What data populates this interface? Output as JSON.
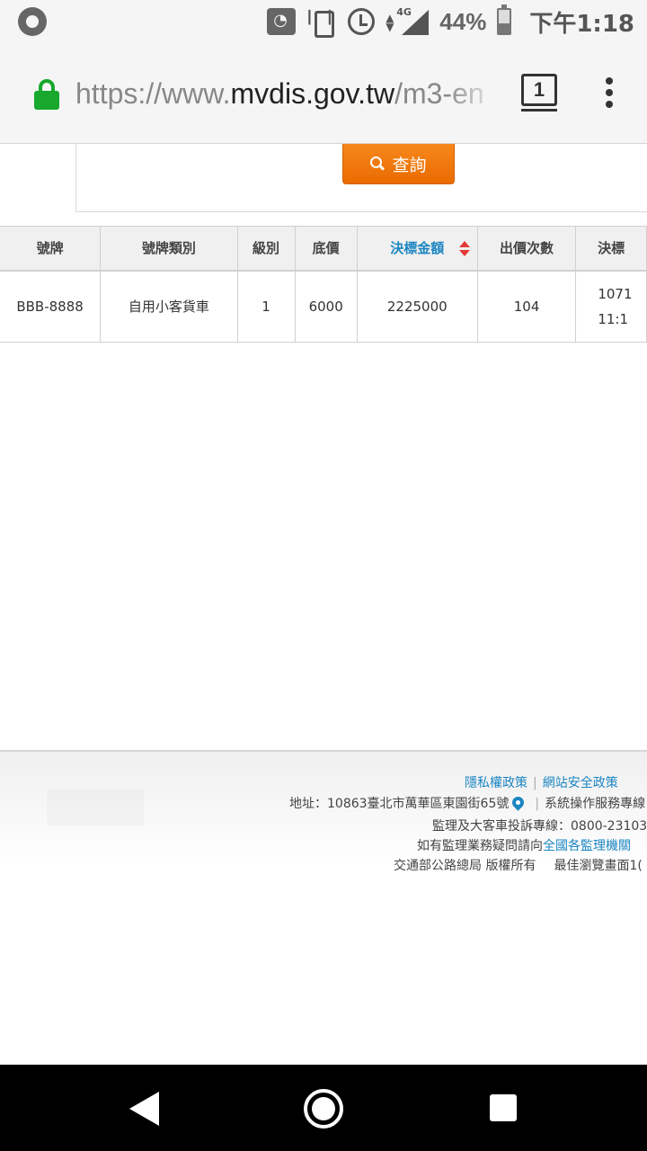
{
  "status_bar": {
    "battery_percent": "44%",
    "clock": "下午1:18",
    "network": "4G",
    "icons": [
      "firefox-icon",
      "wifi-icon",
      "vibrate-icon",
      "alarm-icon",
      "signal-icon",
      "battery-icon"
    ]
  },
  "browser": {
    "url_prefix": "https://www.",
    "url_domain": "mvdis.gov.tw",
    "url_path": "/m3-en",
    "tab_count": "1"
  },
  "search": {
    "button_label": "查詢"
  },
  "table": {
    "columns": [
      "號牌",
      "號牌類別",
      "級別",
      "底價",
      "決標金額",
      "出價次數",
      "決標"
    ],
    "rows": [
      {
        "plate": "BBB-8888",
        "category": "自用小客貨車",
        "level": "1",
        "base_price": "6000",
        "winning_bid": "2225000",
        "bid_count": "104",
        "award_line1": "1071",
        "award_line2": "11:1"
      }
    ],
    "sorted_column": "決標金額"
  },
  "footer": {
    "privacy_link": "隱私權政策",
    "security_link": "網站安全政策",
    "address": "地址：10863臺北市萬華區東園街65號",
    "service_line": "系統操作服務專線",
    "complaint_line": "監理及大客車投訴專線：0800-23103",
    "inquiry_prefix": "如有監理業務疑問請向",
    "inquiry_link": "全國各監理機關",
    "inquiry_suffix": "",
    "copyright": "交通部公路總局 版權所有",
    "best_view": "最佳瀏覽畫面1("
  },
  "colors": {
    "accent_blue": "#1c86c2",
    "search_orange": "#f07a10",
    "lock_green": "#18a82d",
    "sort_red": "#e53935"
  }
}
